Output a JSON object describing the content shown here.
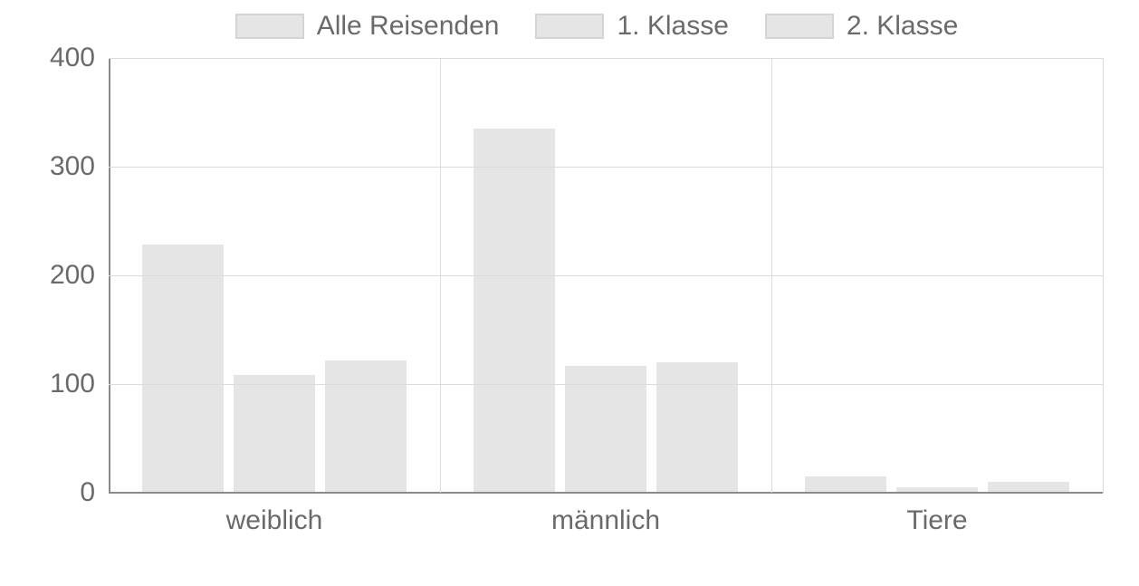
{
  "chart_data": {
    "type": "bar",
    "categories": [
      "weiblich",
      "männlich",
      "Tiere"
    ],
    "series": [
      {
        "name": "Alle Reisenden",
        "values": [
          228,
          335,
          15
        ]
      },
      {
        "name": "1. Klasse",
        "values": [
          108,
          117,
          5
        ]
      },
      {
        "name": "2. Klasse",
        "values": [
          122,
          120,
          10
        ]
      }
    ],
    "ylim": [
      0,
      400
    ],
    "yticks": [
      0,
      100,
      200,
      300,
      400
    ],
    "legend_position": "top",
    "grid": true
  }
}
